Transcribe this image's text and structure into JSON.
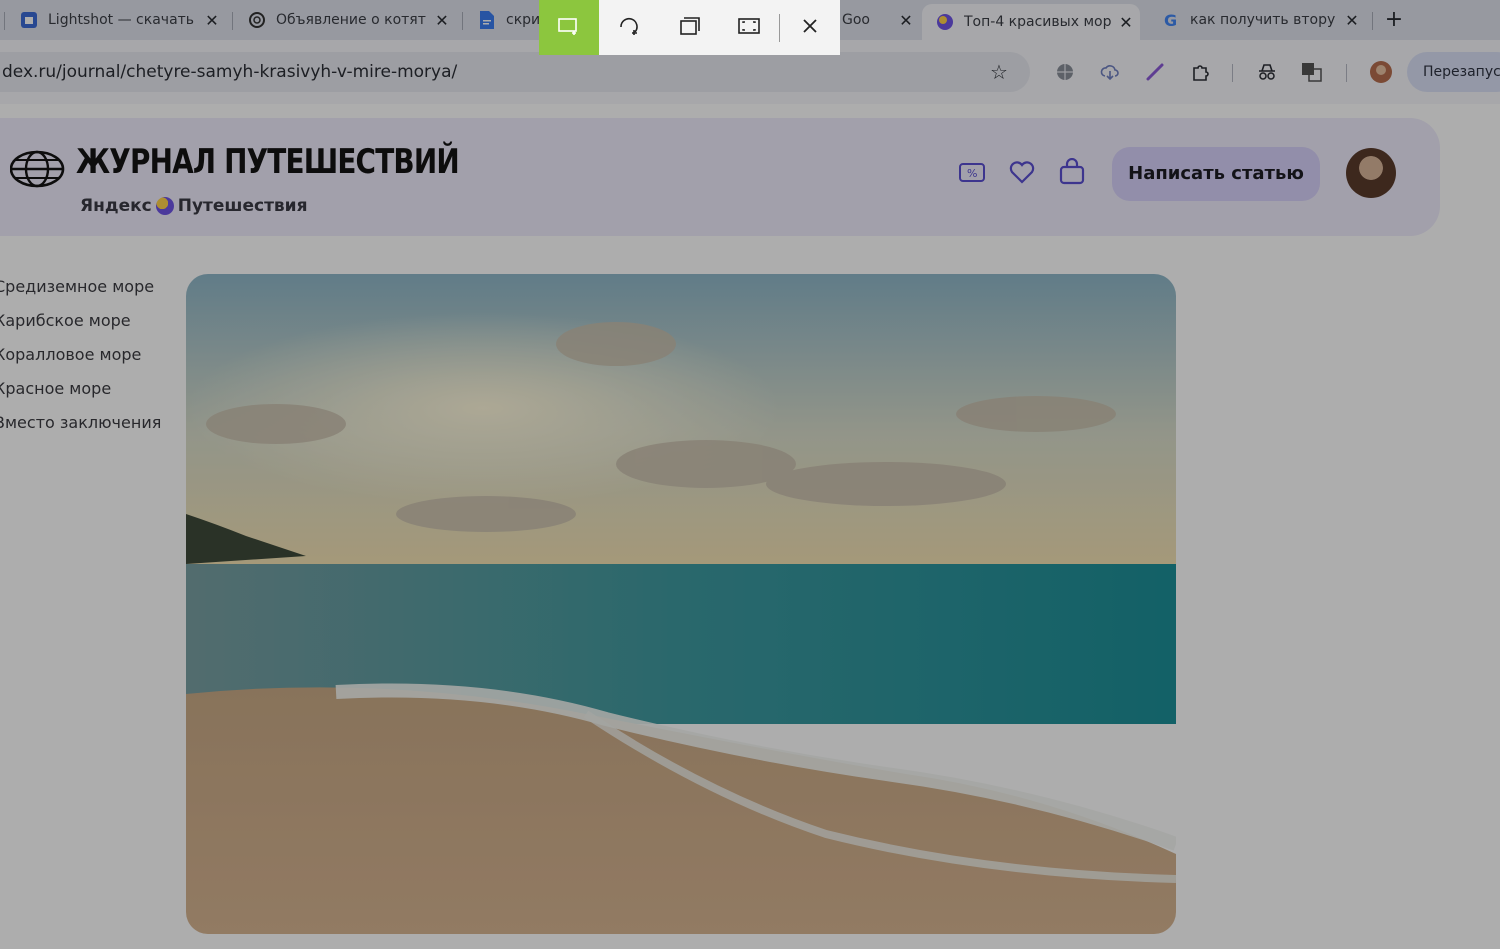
{
  "tabs": [
    {
      "title": "Lightshot — скачать",
      "icon": "lightshot-icon"
    },
    {
      "title": "Объявление о котят",
      "icon": "chatgpt-icon"
    },
    {
      "title": "скри",
      "icon": "google-docs-icon"
    },
    {
      "title": "Goo",
      "icon": "google-icon"
    },
    {
      "title": "Топ-4 красивых мор",
      "icon": "yandex-travel-icon"
    },
    {
      "title": "как получить втору",
      "icon": "google-icon"
    }
  ],
  "address": {
    "url": "dex.ru/journal/chetyre-samyh-krasivyh-v-mire-morya/"
  },
  "relaunch_label": "Перезапуст",
  "site": {
    "title": "ЖУРНАЛ ПУТЕШЕСТВИЙ",
    "brand_left": "Яндекс",
    "brand_right": "Путешествия",
    "write_button": "Написать статью"
  },
  "toc": [
    "Средиземное море",
    "Карибское море",
    "Коралловое море",
    "Красное море",
    "Вместо заключения"
  ],
  "snip_toolbar": {
    "tools": [
      "rectangle-snip-icon",
      "freeform-snip-icon",
      "window-snip-icon",
      "fullscreen-snip-icon",
      "close-icon"
    ],
    "accent": "#8cc63e"
  }
}
